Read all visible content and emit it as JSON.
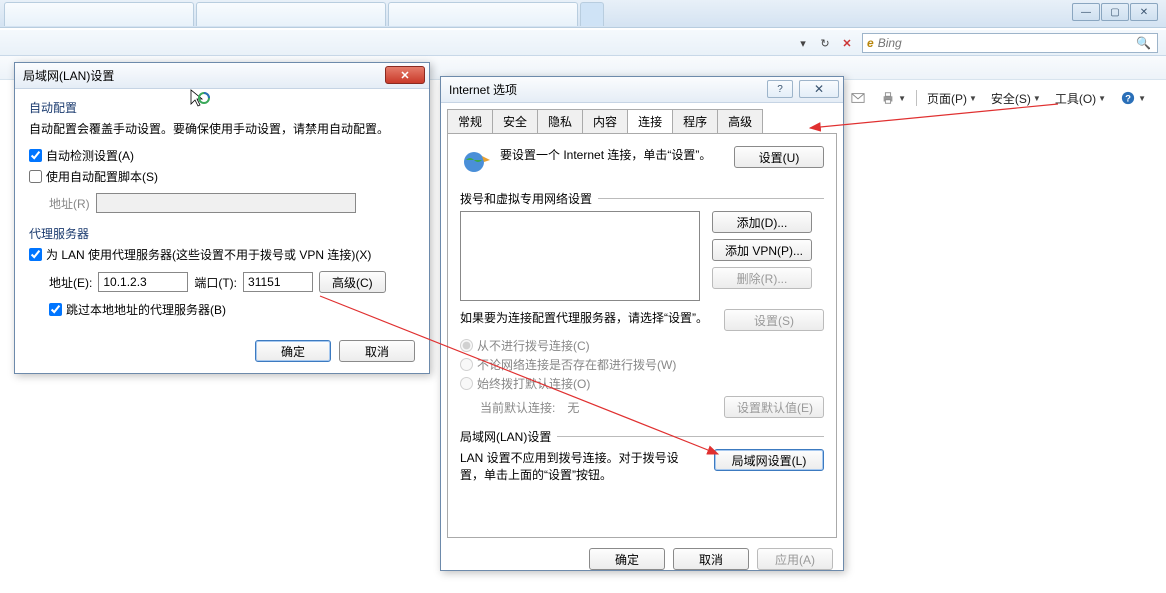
{
  "chrome": {
    "min": "—",
    "max": "▢",
    "close": "✕"
  },
  "search": {
    "hint": "Bing"
  },
  "ie_cmdbar": {
    "home": "",
    "page": "页面(P)",
    "safety": "安全(S)",
    "tools": "工具(O)"
  },
  "lan": {
    "title": "局域网(LAN)设置",
    "auto_group_title": "自动配置",
    "auto_group_desc": "自动配置会覆盖手动设置。要确保使用手动设置，请禁用自动配置。",
    "auto_detect": "自动检测设置(A)",
    "use_script": "使用自动配置脚本(S)",
    "addr_r_label": "地址(R)",
    "proxy_group_title": "代理服务器",
    "use_proxy": "为 LAN 使用代理服务器(这些设置不用于拨号或 VPN 连接)(X)",
    "addr_e_label": "地址(E):",
    "addr_value": "10.1.2.3",
    "port_label": "端口(T):",
    "port_value": "31151",
    "advanced_btn": "高级(C)",
    "bypass_local": "跳过本地地址的代理服务器(B)",
    "ok": "确定",
    "cancel": "取消"
  },
  "io": {
    "title": "Internet 选项",
    "tabs": {
      "general": "常规",
      "security": "安全",
      "privacy": "隐私",
      "content": "内容",
      "connections": "连接",
      "programs": "程序",
      "advanced": "高级"
    },
    "setup_text": "要设置一个 Internet 连接，单击“设置”。",
    "setup_btn": "设置(U)",
    "dialup_label": "拨号和虚拟专用网络设置",
    "add_btn": "添加(D)...",
    "add_vpn_btn": "添加 VPN(P)...",
    "remove_btn": "删除(R)...",
    "settings_btn": "设置(S)",
    "proxy_note": "如果要为连接配置代理服务器，请选择“设置”。",
    "radio_never": "从不进行拨号连接(C)",
    "radio_whenever": "不论网络连接是否存在都进行拨号(W)",
    "radio_always": "始终拨打默认连接(O)",
    "current_default_label": "当前默认连接:",
    "current_default_value": "无",
    "set_default_btn": "设置默认值(E)",
    "lan_label": "局域网(LAN)设置",
    "lan_note": "LAN 设置不应用到拨号连接。对于拨号设置，单击上面的“设置”按钮。",
    "lan_btn": "局域网设置(L)",
    "ok": "确定",
    "cancel": "取消",
    "apply": "应用(A)"
  }
}
